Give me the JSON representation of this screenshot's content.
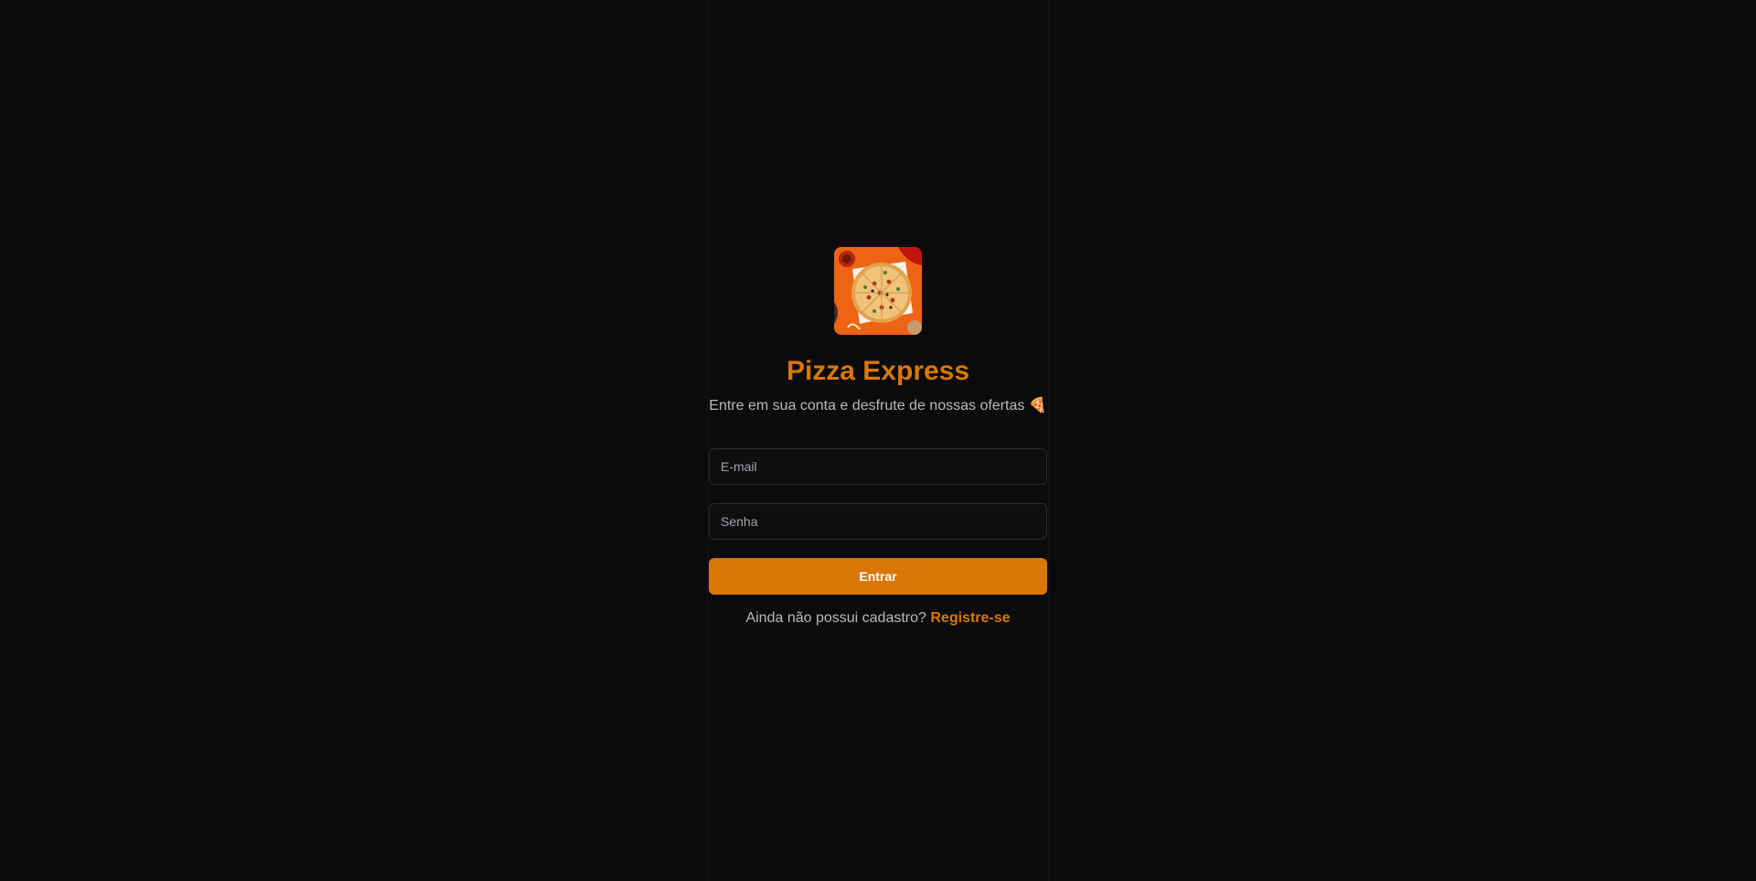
{
  "brand": {
    "name": "Pizza Express",
    "tagline": "Entre em sua conta e desfrute de nossas ofertas 🍕",
    "logo_icon": "pizza-logo",
    "accent_color": "#d97706"
  },
  "login_form": {
    "email_placeholder": "E-mail",
    "password_placeholder": "Senha",
    "submit_label": "Entrar"
  },
  "register_prompt": {
    "text": "Ainda não possui cadastro?",
    "link_label": "Registre-se"
  }
}
